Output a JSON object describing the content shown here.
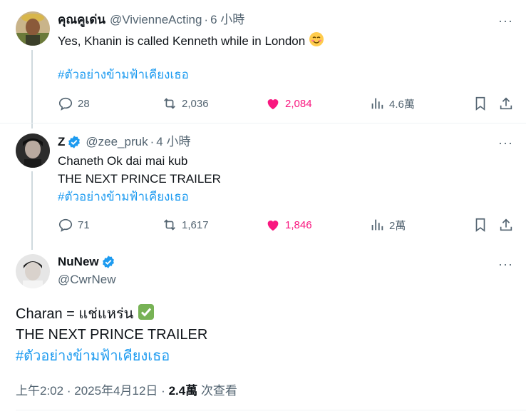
{
  "tweets": [
    {
      "name": "คุณคูเด่น",
      "handle": "@VivienneActing",
      "time": "6 小時",
      "text": "Yes, Khanin is called Kenneth while in London",
      "hashtag": "#ตัวอย่างข้ามฟ้าเคียงเธอ",
      "replies": "28",
      "retweets": "2,036",
      "likes": "2,084",
      "views": "4.6萬"
    },
    {
      "name": "Z",
      "handle": "@zee_pruk",
      "time": "4 小時",
      "line1": "Chaneth Ok dai mai kub",
      "line2": "THE NEXT PRINCE TRAILER",
      "hashtag": "#ตัวอย่างข้ามฟ้าเคียงเธอ",
      "replies": "71",
      "retweets": "1,617",
      "likes": "1,846",
      "views": "2萬"
    }
  ],
  "main": {
    "name": "NuNew",
    "handle": "@CwrNew",
    "line1": "Charan = แช่แหร่น",
    "line2": "THE NEXT PRINCE TRAILER",
    "hashtag": "#ตัวอย่างข้ามฟ้าเคียงเธอ",
    "time": "上午2:02",
    "date": "2025年4月12日",
    "views_count": "2.4萬",
    "views_label": "次查看"
  },
  "dot": "·",
  "more": "···",
  "colors": {
    "accent": "#1d9bf0",
    "like": "#f91880",
    "muted": "#536471"
  }
}
